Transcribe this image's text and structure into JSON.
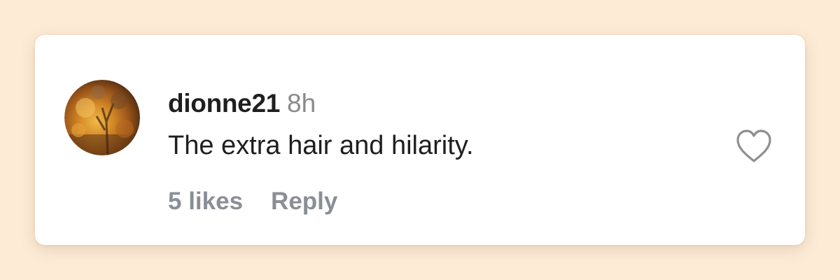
{
  "comment": {
    "username": "dionne21",
    "time": "8h",
    "text": "The extra hair and hilarity.",
    "likes_label": "5 likes",
    "reply_label": "Reply",
    "liked": false
  },
  "colors": {
    "background": "#fdebd6",
    "card": "#ffffff",
    "text_primary": "#1f1f1f",
    "text_secondary": "#8a8a8a",
    "action_text": "#8a8f96"
  },
  "icons": {
    "like": "heart-outline-icon",
    "avatar": "user-avatar"
  }
}
